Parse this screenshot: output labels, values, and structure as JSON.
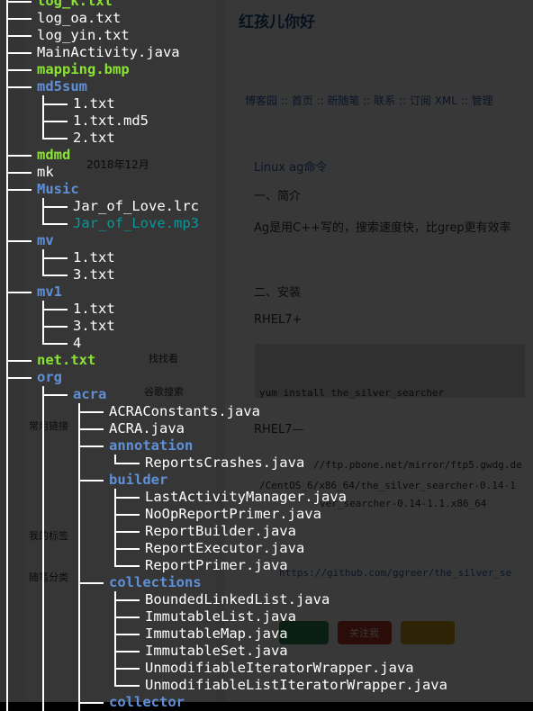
{
  "background_page": {
    "blog_title": "红孩儿你好",
    "nav": "博客园 :: 首页 :: 新随笔 :: 联系 :: 订阅 XML :: 管理",
    "calendar_title": "2018年12月",
    "post_title": "Linux ag命令",
    "section_intro": "一、简介",
    "intro_text": "Ag是用C++写的，搜索速度快，比grep更有效率",
    "section_install": "二、安装",
    "rhel7": "RHEL7+",
    "yum_cmd": "yum install the_silver_searcher",
    "rhel7_minus": "RHEL7—",
    "url1": "//ftp.pbone.net/mirror/ftp5.gwdg.de",
    "url2": "/CentOS_6/x86_64/the_silver_searcher-0.14-1",
    "url3": "ver_searcher-0.14-1.1.x86_64",
    "url4": "https://github.com/ggreer/the_silver_se",
    "search_button": "找找看",
    "google_button": "谷歌搜索",
    "follow_button": "关注我",
    "tags_heading": "我的标签",
    "links_heading": "常用链接",
    "categories_heading": "随笔分类"
  },
  "tree": [
    {
      "depth": 0,
      "name": "log_k.txt",
      "type": "img",
      "last": false
    },
    {
      "depth": 0,
      "name": "log_oa.txt",
      "type": "file",
      "last": false
    },
    {
      "depth": 0,
      "name": "log_yin.txt",
      "type": "file",
      "last": false
    },
    {
      "depth": 0,
      "name": "MainActivity.java",
      "type": "file",
      "last": false
    },
    {
      "depth": 0,
      "name": "mapping.bmp",
      "type": "img",
      "last": false
    },
    {
      "depth": 0,
      "name": "md5sum",
      "type": "dir",
      "last": false
    },
    {
      "depth": 1,
      "name": "1.txt",
      "type": "file",
      "last": false,
      "pass": [
        true
      ]
    },
    {
      "depth": 1,
      "name": "1.txt.md5",
      "type": "file",
      "last": false,
      "pass": [
        true
      ]
    },
    {
      "depth": 1,
      "name": "2.txt",
      "type": "file",
      "last": true,
      "pass": [
        true
      ]
    },
    {
      "depth": 0,
      "name": "mdmd",
      "type": "exe",
      "last": false
    },
    {
      "depth": 0,
      "name": "mk",
      "type": "file",
      "last": false
    },
    {
      "depth": 0,
      "name": "Music",
      "type": "dir",
      "last": false
    },
    {
      "depth": 1,
      "name": "Jar_of_Love.lrc",
      "type": "file",
      "last": false,
      "pass": [
        true
      ]
    },
    {
      "depth": 1,
      "name": "Jar_of_Love.mp3",
      "type": "media",
      "last": true,
      "pass": [
        true
      ]
    },
    {
      "depth": 0,
      "name": "mv",
      "type": "dir",
      "last": false
    },
    {
      "depth": 1,
      "name": "1.txt",
      "type": "file",
      "last": false,
      "pass": [
        true
      ]
    },
    {
      "depth": 1,
      "name": "3.txt",
      "type": "file",
      "last": true,
      "pass": [
        true
      ]
    },
    {
      "depth": 0,
      "name": "mv1",
      "type": "dir",
      "last": false
    },
    {
      "depth": 1,
      "name": "1.txt",
      "type": "file",
      "last": false,
      "pass": [
        true
      ]
    },
    {
      "depth": 1,
      "name": "3.txt",
      "type": "file",
      "last": false,
      "pass": [
        true
      ]
    },
    {
      "depth": 1,
      "name": "4",
      "type": "file",
      "last": true,
      "pass": [
        true
      ]
    },
    {
      "depth": 0,
      "name": "net.txt",
      "type": "img",
      "last": false
    },
    {
      "depth": 0,
      "name": "org",
      "type": "dir",
      "last": false
    },
    {
      "depth": 1,
      "name": "acra",
      "type": "dir",
      "last": false,
      "pass": [
        true
      ]
    },
    {
      "depth": 2,
      "name": "ACRAConstants.java",
      "type": "file",
      "last": false,
      "pass": [
        true,
        true
      ]
    },
    {
      "depth": 2,
      "name": "ACRA.java",
      "type": "file",
      "last": false,
      "pass": [
        true,
        true
      ]
    },
    {
      "depth": 2,
      "name": "annotation",
      "type": "dir",
      "last": false,
      "pass": [
        true,
        true
      ]
    },
    {
      "depth": 3,
      "name": "ReportsCrashes.java",
      "type": "file",
      "last": true,
      "pass": [
        true,
        true,
        true
      ]
    },
    {
      "depth": 2,
      "name": "builder",
      "type": "dir",
      "last": false,
      "pass": [
        true,
        true
      ]
    },
    {
      "depth": 3,
      "name": "LastActivityManager.java",
      "type": "file",
      "last": false,
      "pass": [
        true,
        true,
        true
      ]
    },
    {
      "depth": 3,
      "name": "NoOpReportPrimer.java",
      "type": "file",
      "last": false,
      "pass": [
        true,
        true,
        true
      ]
    },
    {
      "depth": 3,
      "name": "ReportBuilder.java",
      "type": "file",
      "last": false,
      "pass": [
        true,
        true,
        true
      ]
    },
    {
      "depth": 3,
      "name": "ReportExecutor.java",
      "type": "file",
      "last": false,
      "pass": [
        true,
        true,
        true
      ]
    },
    {
      "depth": 3,
      "name": "ReportPrimer.java",
      "type": "file",
      "last": true,
      "pass": [
        true,
        true,
        true
      ]
    },
    {
      "depth": 2,
      "name": "collections",
      "type": "dir",
      "last": false,
      "pass": [
        true,
        true
      ]
    },
    {
      "depth": 3,
      "name": "BoundedLinkedList.java",
      "type": "file",
      "last": false,
      "pass": [
        true,
        true,
        true
      ]
    },
    {
      "depth": 3,
      "name": "ImmutableList.java",
      "type": "file",
      "last": false,
      "pass": [
        true,
        true,
        true
      ]
    },
    {
      "depth": 3,
      "name": "ImmutableMap.java",
      "type": "file",
      "last": false,
      "pass": [
        true,
        true,
        true
      ]
    },
    {
      "depth": 3,
      "name": "ImmutableSet.java",
      "type": "file",
      "last": false,
      "pass": [
        true,
        true,
        true
      ]
    },
    {
      "depth": 3,
      "name": "UnmodifiableIteratorWrapper.java",
      "type": "file",
      "last": false,
      "pass": [
        true,
        true,
        true
      ]
    },
    {
      "depth": 3,
      "name": "UnmodifiableListIteratorWrapper.java",
      "type": "file",
      "last": true,
      "pass": [
        true,
        true,
        true
      ]
    },
    {
      "depth": 2,
      "name": "collector",
      "type": "dir",
      "last": false,
      "pass": [
        true,
        true
      ]
    }
  ]
}
